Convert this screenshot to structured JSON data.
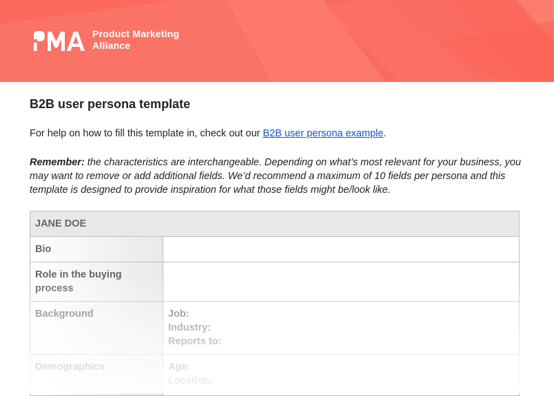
{
  "banner": {
    "logo_text": "PMA",
    "brand_line1": "Product Marketing",
    "brand_line2": "Alliance",
    "bg_color": "#fb6a5c"
  },
  "document": {
    "title": "B2B user persona template",
    "help_prefix": "For help on how to fill this template in, check out our ",
    "help_link": "B2B user persona example",
    "help_suffix": ".",
    "remember_label": "Remember:",
    "remember_text": " the characteristics are interchangeable. Depending on what’s most relevant for your business, you may want to remove or add additional fields. We’d recommend a maximum of 10 fields per persona and this template is designed to provide inspiration for what those fields might be/look like."
  },
  "table": {
    "header": "JANE DOE",
    "rows": [
      {
        "label": "Bio",
        "values": []
      },
      {
        "label": "Role in the buying process",
        "values": []
      },
      {
        "label": "Background",
        "values": [
          "Job:",
          "Industry:",
          "Reports to:"
        ]
      },
      {
        "label": "Demographics",
        "values": [
          "Age:",
          "Location:"
        ]
      }
    ]
  },
  "colors": {
    "link": "#1155cc",
    "header_bg": "#e8e8e8"
  }
}
